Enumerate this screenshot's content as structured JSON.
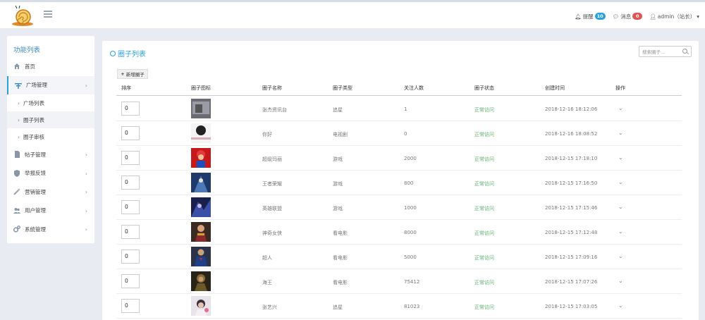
{
  "topbar": {
    "remind_label": "提醒",
    "remind_count": "10",
    "remind_color": "#2aa0d8",
    "message_label": "消息",
    "message_count": "0",
    "message_color": "#e05454",
    "user_label": "admin（站长）"
  },
  "sidebar": {
    "title": "功能列表",
    "items": [
      {
        "label": "首页",
        "icon": "home-icon"
      },
      {
        "label": "广场管理",
        "icon": "square-icon"
      },
      {
        "label": "广场列表"
      },
      {
        "label": "圈子列表"
      },
      {
        "label": "圈子审核"
      },
      {
        "label": "帖子管理",
        "icon": "document-icon"
      },
      {
        "label": "举报反馈",
        "icon": "shield-icon"
      },
      {
        "label": "营销管理",
        "icon": "wand-icon"
      },
      {
        "label": "用户管理",
        "icon": "users-icon"
      },
      {
        "label": "系统管理",
        "icon": "gears-icon"
      }
    ]
  },
  "main": {
    "title": "圈子列表",
    "search_placeholder": "搜索圈子...",
    "add_button": "新增圈子",
    "columns": [
      "排序",
      "圈子图标",
      "圈子名称",
      "圈子类型",
      "关注人数",
      "圈子状态",
      "创建时间",
      "操作"
    ],
    "rows": [
      {
        "sort": "0",
        "name": "张杰资讯台",
        "type": "追星",
        "followers": "1",
        "status": "正常访问",
        "created": "2018-12-16 18:12:06"
      },
      {
        "sort": "0",
        "name": "你好",
        "type": "电视剧",
        "followers": "0",
        "status": "正常访问",
        "created": "2018-12-16 18:08:52"
      },
      {
        "sort": "0",
        "name": "超级玛丽",
        "type": "游戏",
        "followers": "2000",
        "status": "正常访问",
        "created": "2018-12-15 17:18:10"
      },
      {
        "sort": "0",
        "name": "王者荣耀",
        "type": "游戏",
        "followers": "800",
        "status": "正常访问",
        "created": "2018-12-15 17:16:50"
      },
      {
        "sort": "0",
        "name": "英雄联盟",
        "type": "游戏",
        "followers": "1000",
        "status": "正常访问",
        "created": "2018-12-15 17:15:46"
      },
      {
        "sort": "0",
        "name": "神奇女侠",
        "type": "看电影",
        "followers": "8000",
        "status": "正常访问",
        "created": "2018-12-15 17:12:48"
      },
      {
        "sort": "0",
        "name": "超人",
        "type": "看电影",
        "followers": "5000",
        "status": "正常访问",
        "created": "2018-12-15 17:09:16"
      },
      {
        "sort": "0",
        "name": "海王",
        "type": "看电影",
        "followers": "75412",
        "status": "正常访问",
        "created": "2018-12-15 17:07:26"
      },
      {
        "sort": "0",
        "name": "张艺兴",
        "type": "追星",
        "followers": "81023",
        "status": "正常访问",
        "created": "2018-12-15 17:03:05"
      }
    ]
  }
}
